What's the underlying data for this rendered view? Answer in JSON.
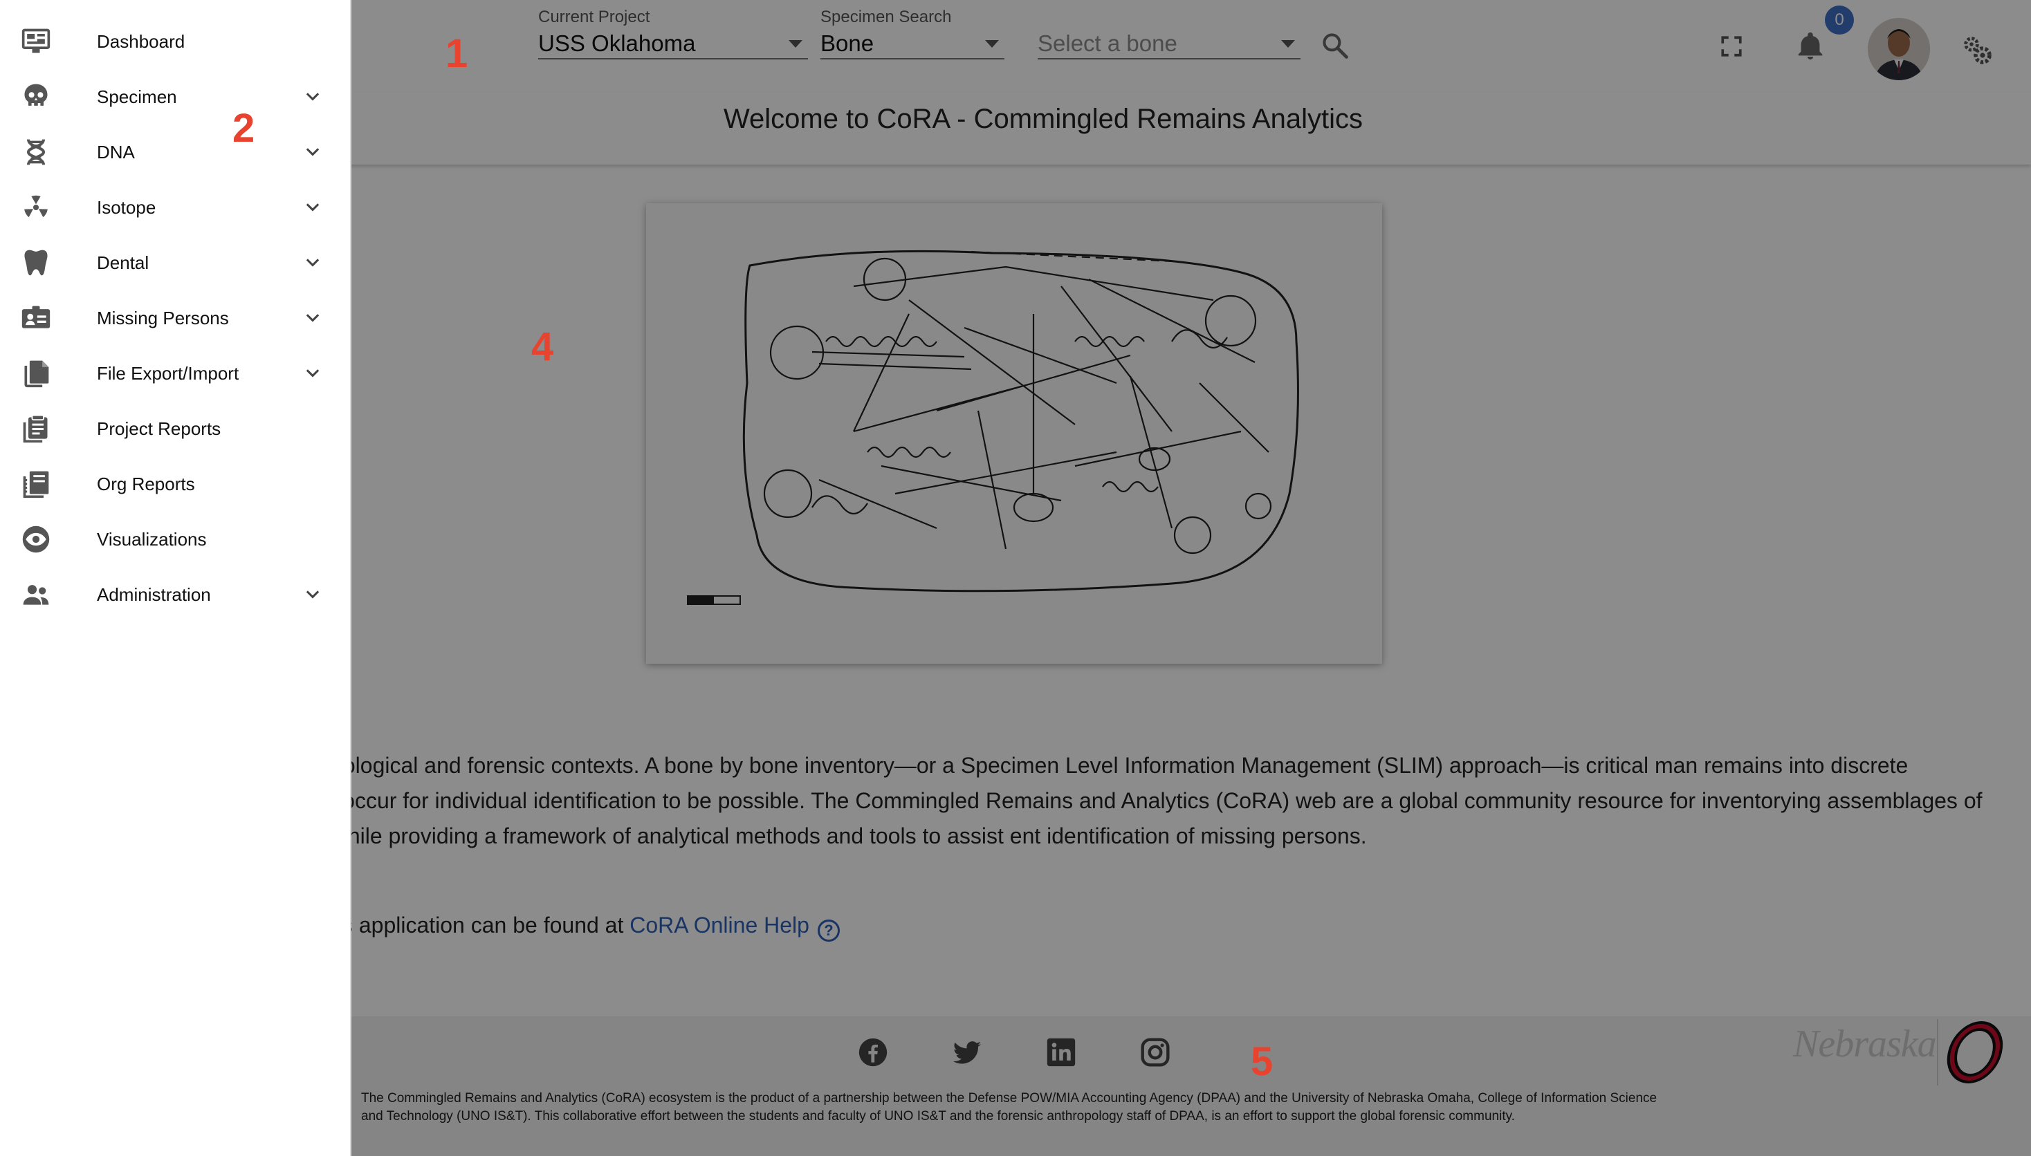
{
  "header": {
    "current_project_label": "Current Project",
    "current_project_value": "USS Oklahoma",
    "specimen_search_label": "Specimen Search",
    "specimen_search_value": "Bone",
    "bone_select_placeholder": "Select a bone",
    "notification_count": "0"
  },
  "welcome": {
    "title": "Welcome to CoRA - Commingled Remains Analytics"
  },
  "about": {
    "paragraph": "re often encountered in archaeological and forensic contexts. A bone by bone inventory—or a Specimen Level Information Management (SLIM) approach—is critical man remains into discrete individuals. This process must occur for individual identification to be possible. The Commingled Remains and Analytics (CoRA) web are a global community resource for inventorying assemblages of commingled human remains, while providing a framework of analytical methods and tools to assist ent identification of missing persons.",
    "help_prefix": "Commingled Remains Analytics application can be found at ",
    "help_link": "CoRA Online Help",
    "help_icon_glyph": "?"
  },
  "footer": {
    "text": "The Commingled Remains and Analytics (CoRA) ecosystem is the product of a partnership between the Defense POW/MIA Accounting Agency (DPAA) and the University of Nebraska Omaha, College of Information Science and Technology (UNO IS&T). This collaborative effort between the students and faculty of UNO IS&T and the forensic anthropology staff of DPAA, is an effort to support the global forensic community.",
    "nebraska_logo_text": "Nebraska",
    "social_icons": [
      "facebook-icon",
      "twitter-icon",
      "linkedin-icon",
      "instagram-icon"
    ]
  },
  "sidebar": {
    "items": [
      {
        "label": "Dashboard",
        "icon": "dashboard-icon",
        "expandable": false
      },
      {
        "label": "Specimen",
        "icon": "skull-icon",
        "expandable": true
      },
      {
        "label": "DNA",
        "icon": "dna-icon",
        "expandable": true
      },
      {
        "label": "Isotope",
        "icon": "radiation-icon",
        "expandable": true
      },
      {
        "label": "Dental",
        "icon": "tooth-icon",
        "expandable": true
      },
      {
        "label": "Missing Persons",
        "icon": "id-card-icon",
        "expandable": true
      },
      {
        "label": "File Export/Import",
        "icon": "files-icon",
        "expandable": true
      },
      {
        "label": "Project Reports",
        "icon": "clipboard-icon",
        "expandable": false
      },
      {
        "label": "Org Reports",
        "icon": "book-icon",
        "expandable": false
      },
      {
        "label": "Visualizations",
        "icon": "eye-icon",
        "expandable": false
      },
      {
        "label": "Administration",
        "icon": "people-icon",
        "expandable": true
      }
    ]
  },
  "callouts": [
    "1",
    "2",
    "4",
    "5"
  ],
  "colors": {
    "callout": "#e8432e",
    "link": "#2e5fb5",
    "badge": "#3f6fc4",
    "scrim": "rgba(0,0,0,0.45)"
  }
}
